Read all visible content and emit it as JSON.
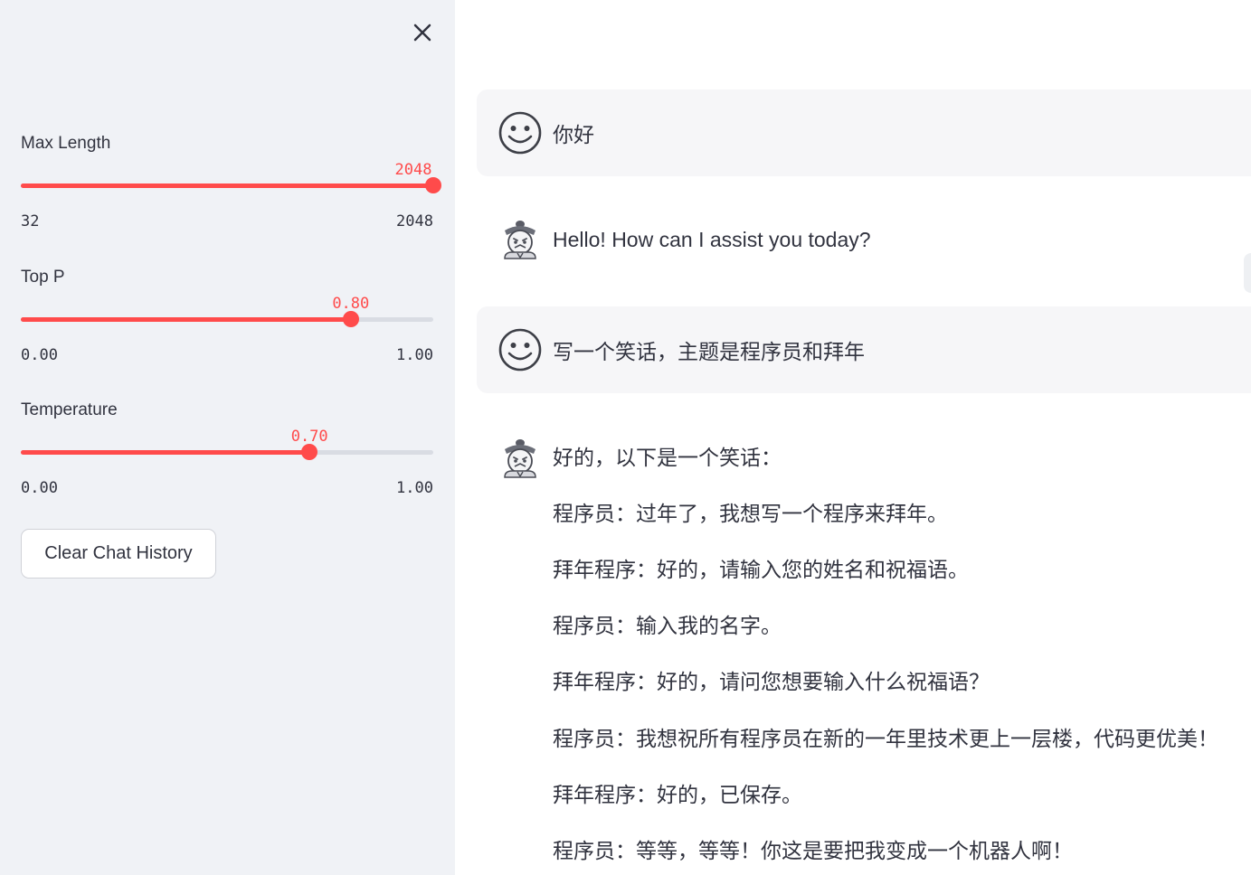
{
  "sidebar": {
    "close_icon": "close-icon",
    "sliders": [
      {
        "label": "Max Length",
        "value": "2048",
        "min": "32",
        "max": "2048",
        "fraction": 1.0
      },
      {
        "label": "Top P",
        "value": "0.80",
        "min": "0.00",
        "max": "1.00",
        "fraction": 0.8
      },
      {
        "label": "Temperature",
        "value": "0.70",
        "min": "0.00",
        "max": "1.00",
        "fraction": 0.7
      }
    ],
    "clear_button_label": "Clear Chat History"
  },
  "colors": {
    "accent": "#ff4b4b",
    "sidebar_bg": "#f0f2f6",
    "user_bubble_bg": "#f6f6f8",
    "text": "#31333f"
  },
  "chat": {
    "messages": [
      {
        "role": "user",
        "avatar": "smiley-user-icon",
        "text": "你好"
      },
      {
        "role": "assistant",
        "avatar": "robot-assistant-icon",
        "text": "Hello! How can I assist you today?"
      },
      {
        "role": "user",
        "avatar": "smiley-user-icon",
        "text": "写一个笑话，主题是程序员和拜年"
      },
      {
        "role": "assistant",
        "avatar": "robot-assistant-icon",
        "lines": [
          "好的，以下是一个笑话：",
          "程序员：过年了，我想写一个程序来拜年。",
          "拜年程序：好的，请输入您的姓名和祝福语。",
          "程序员：输入我的名字。",
          "拜年程序：好的，请问您想要输入什么祝福语？",
          "程序员：我想祝所有程序员在新的一年里技术更上一层楼，代码更优美！",
          "拜年程序：好的，已保存。",
          "程序员：等等，等等！你这是要把我变成一个机器人啊！"
        ]
      }
    ]
  }
}
